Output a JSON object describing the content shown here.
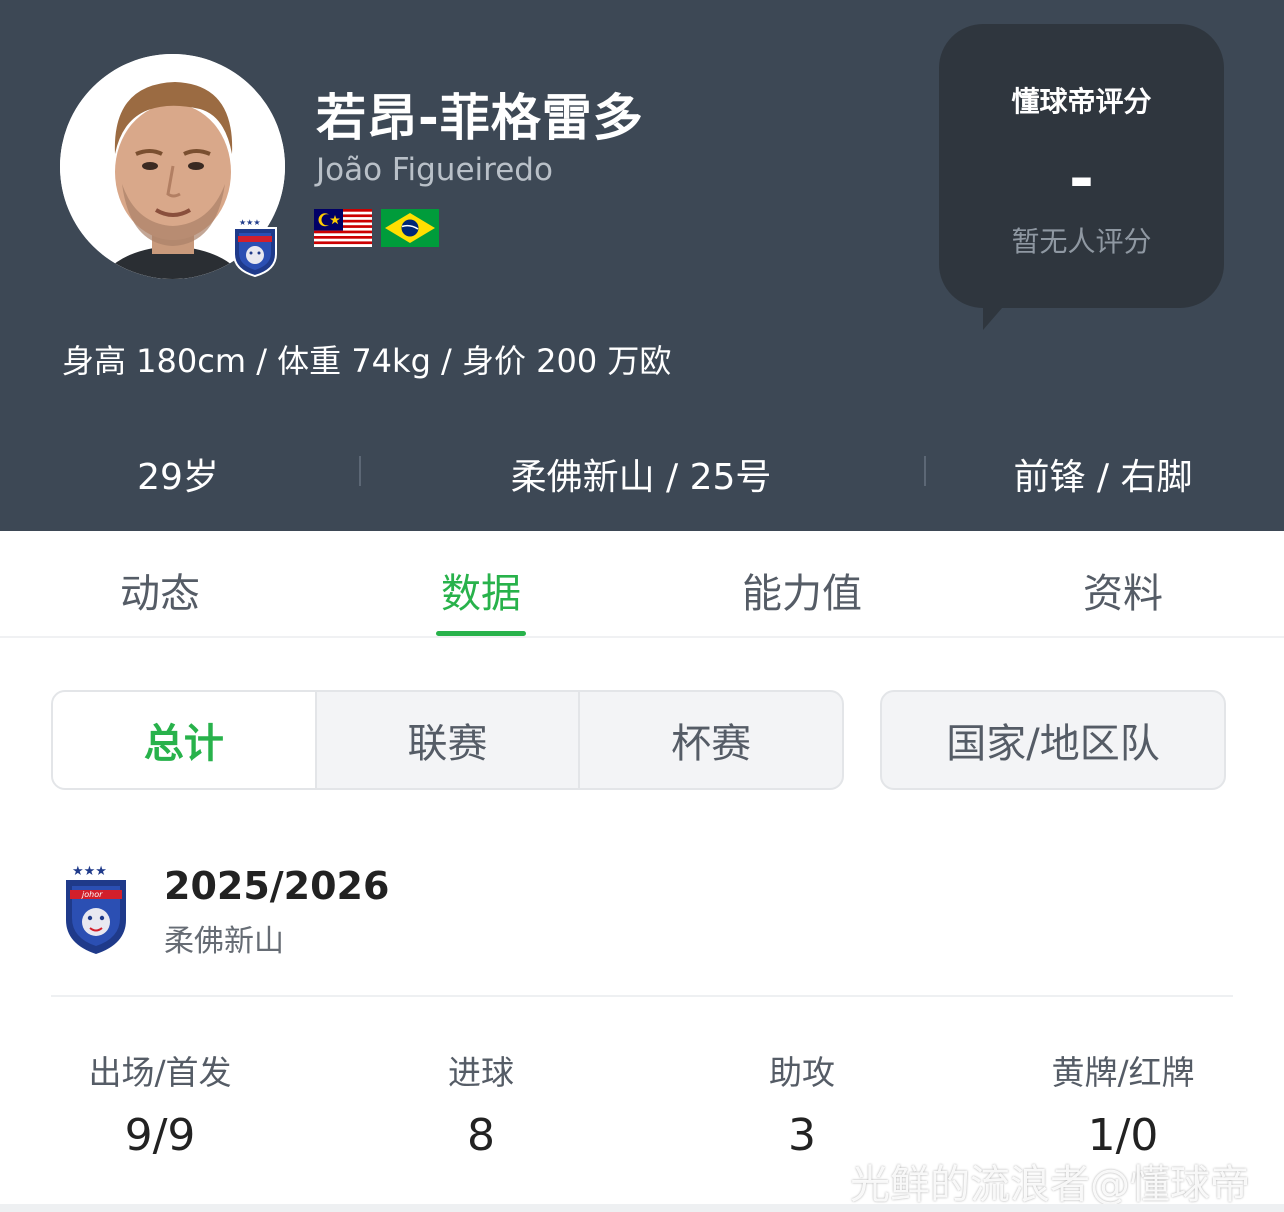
{
  "player": {
    "name_cn": "若昂-菲格雷多",
    "name_en": "João Figueiredo",
    "flags": [
      "malaysia-flag",
      "brazil-flag"
    ],
    "physical": "身高 180cm / 体重 74kg / 身价 200 万欧",
    "age": "29岁",
    "club_number": "柔佛新山 / 25号",
    "position_foot": "前锋 / 右脚"
  },
  "rating": {
    "title": "懂球帝评分",
    "value": "-",
    "subtitle": "暂无人评分"
  },
  "tabs": [
    {
      "label": "动态",
      "active": false
    },
    {
      "label": "数据",
      "active": true
    },
    {
      "label": "能力值",
      "active": false
    },
    {
      "label": "资料",
      "active": false
    }
  ],
  "segments": [
    {
      "label": "总计",
      "active": true
    },
    {
      "label": "联赛",
      "active": false
    },
    {
      "label": "杯赛",
      "active": false
    }
  ],
  "nation_segment": {
    "label": "国家/地区队"
  },
  "season": {
    "title": "2025/2026",
    "team": "柔佛新山"
  },
  "stats": [
    {
      "label": "出场/首发",
      "value": "9/9"
    },
    {
      "label": "进球",
      "value": "8"
    },
    {
      "label": "助攻",
      "value": "3"
    },
    {
      "label": "黄牌/红牌",
      "value": "1/0"
    }
  ],
  "watermark": "光鲜的流浪者@懂球帝",
  "colors": {
    "header_bg": "#3d4855",
    "accent_green": "#28b24b",
    "bubble_bg": "#2f363e"
  }
}
